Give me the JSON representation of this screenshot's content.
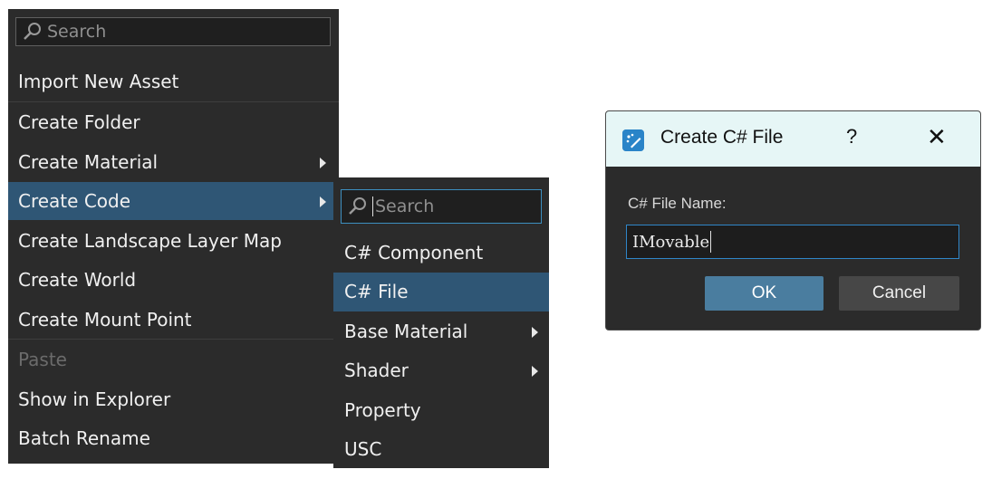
{
  "context_menu": {
    "search_placeholder": "Search",
    "items": [
      {
        "label": "Import New Asset"
      },
      {
        "label": "Create Folder"
      },
      {
        "label": "Create Material"
      },
      {
        "label": "Create Code"
      },
      {
        "label": "Create Landscape Layer Map"
      },
      {
        "label": "Create World"
      },
      {
        "label": "Create Mount Point"
      },
      {
        "label": "Paste"
      },
      {
        "label": "Show in Explorer"
      },
      {
        "label": "Batch Rename"
      }
    ],
    "highlighted_item": "Create Code",
    "disabled_item": "Paste"
  },
  "submenu": {
    "search_placeholder": "Search",
    "items": [
      {
        "label": "C# Component"
      },
      {
        "label": "C# File"
      },
      {
        "label": "Base Material"
      },
      {
        "label": "Shader"
      },
      {
        "label": "Property"
      },
      {
        "label": "USC"
      }
    ],
    "highlighted_item": "C# File"
  },
  "dialog": {
    "title": "Create C# File",
    "help_label": "?",
    "close_label": "✕",
    "field_label": "C# File Name:",
    "field_value": "IMovable",
    "ok_label": "OK",
    "cancel_label": "Cancel"
  },
  "icons": {
    "search": "magnifier-icon",
    "submenu_arrow": "chevron-right-icon",
    "app": "app-icon"
  },
  "colors": {
    "menu_bg": "#2b2b2b",
    "highlight": "#2f5675",
    "focus_border": "#2f86c8",
    "titlebar_bg": "#e6f6f6",
    "ok_button": "#4a7d9f"
  }
}
